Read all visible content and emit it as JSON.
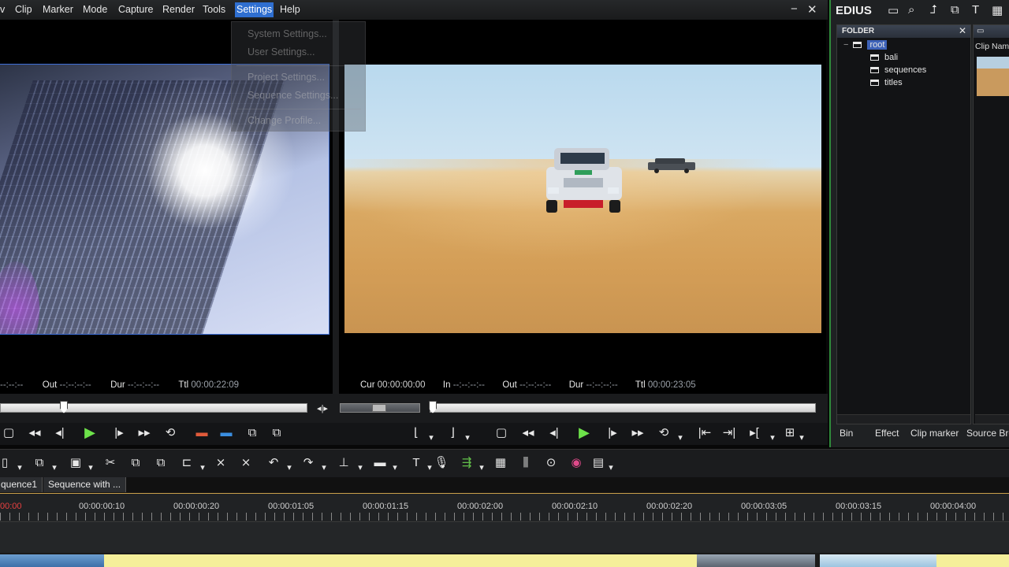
{
  "menu": {
    "items": [
      {
        "id": "view",
        "label": "v"
      },
      {
        "id": "clip",
        "label": "Clip"
      },
      {
        "id": "marker",
        "label": "Marker"
      },
      {
        "id": "mode",
        "label": "Mode"
      },
      {
        "id": "capture",
        "label": "Capture"
      },
      {
        "id": "render",
        "label": "Render"
      },
      {
        "id": "tools",
        "label": "Tools"
      },
      {
        "id": "settings",
        "label": "Settings"
      },
      {
        "id": "help",
        "label": "Help"
      }
    ],
    "minimize": "−",
    "close": "✕"
  },
  "settings_menu": {
    "items": [
      "System Settings...",
      "User Settings...",
      "Project Settings...",
      "Sequence Settings...",
      "Change Profile..."
    ]
  },
  "source_player": {
    "timecode": {
      "in_value": "--:--:--",
      "out_label": "Out",
      "out_value": "--:--:--:--",
      "dur_label": "Dur",
      "dur_value": "--:--:--:--",
      "ttl_label": "Ttl",
      "ttl_value": "00:00:22:09"
    }
  },
  "record_player": {
    "timecode": {
      "cur_label": "Cur",
      "cur_value": "00:00:00:00",
      "in_label": "In",
      "in_value": "--:--:--:--",
      "out_label": "Out",
      "out_value": "--:--:--:--",
      "dur_label": "Dur",
      "dur_value": "--:--:--:--",
      "ttl_label": "Ttl",
      "ttl_value": "00:00:23:05"
    }
  },
  "bin": {
    "app_title": "EDIUS",
    "folder_header": "FOLDER",
    "clip_header": "Clip Name",
    "tree": [
      "root",
      "bali",
      "sequences",
      "titles"
    ],
    "tabs": [
      "Bin",
      "Effect",
      "Clip marker",
      "Source Bro"
    ]
  },
  "timeline": {
    "tabs": [
      "quence1",
      "Sequence with ..."
    ],
    "ruler": [
      "00:00",
      "00:00:00:10",
      "00:00:00:20",
      "00:00:01:05",
      "00:00:01:15",
      "00:00:02:00",
      "00:00:02:10",
      "00:00:02:20",
      "00:00:03:05",
      "00:00:03:15",
      "00:00:04:00"
    ]
  },
  "colors": {
    "accent": "#2f6fd0",
    "play_green": "#6de24a",
    "panel_border_green": "#2f8a3a"
  }
}
